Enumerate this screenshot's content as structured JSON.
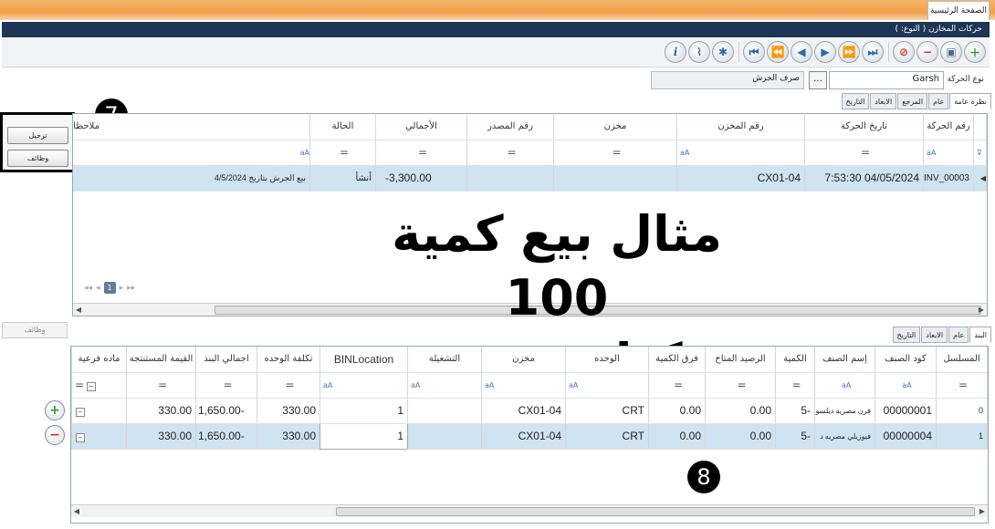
{
  "header": {
    "home_tab": "الصفحة الرئيسية",
    "window_title": "حركات المخازن  ( النوع:  )"
  },
  "toolbar": {
    "buttons": [
      "add-icon",
      "save-icon",
      "remove-icon",
      "cancel-icon",
      "last-icon",
      "next-fast-icon",
      "next-icon",
      "prev-icon",
      "prev-fast-icon",
      "first-icon",
      "export-icon",
      "attach-icon",
      "info-icon"
    ]
  },
  "form": {
    "movement_type_label": "نوع الحركة",
    "movement_type_value": "Garsh",
    "movement_type_name": "صرف الجرش",
    "browse_label": "..."
  },
  "top_tabs": [
    "نظرة عامة",
    "عام",
    "المرجع",
    "الابعاد",
    "التاريخ"
  ],
  "side_buttons": {
    "post": "ترحيل",
    "functions": "وظائف"
  },
  "badges": {
    "b7": "7",
    "b8": "8"
  },
  "header_grid": {
    "columns": [
      "رقم الحركة",
      "تاريخ الحركة",
      "رقم المخزن",
      "مخزن",
      "رقم المصدر",
      "الأجمالي",
      "الحالة",
      "ملاحظات"
    ],
    "filter_marker": "aA",
    "rows": [
      [
        "INV_00003",
        "04/05/2024 7:53:30",
        "CX01-04",
        "",
        "",
        "3,300.00-",
        "أنشأ",
        "بيع الجرش بتاريخ 4/5/2024"
      ]
    ]
  },
  "pager": {
    "page": "1"
  },
  "overlay": {
    "line1": "مثال بيع كمية 100",
    "line2": "كيلو جرش"
  },
  "lines": {
    "functions_label": "وظائف",
    "tabs": [
      "البند",
      "عام",
      "الابعاد",
      "التاريخ"
    ],
    "columns": [
      "المسلسل",
      "كود الصنف",
      "إسم الصنف",
      "الكمية",
      "الرصيد المتاح",
      "فرق الكمية",
      "الوحده",
      "مخزن",
      "التشغيلة",
      "BINLocation",
      "تكلفة الوحده",
      "اجمالي البند",
      "القيمة المستنتجة",
      "ماده فرعية"
    ],
    "rows": [
      [
        "0",
        "00000001",
        "فرن مصريه ديلسو",
        "-5",
        "0.00",
        "0.00",
        "CRT",
        "CX01-04",
        "",
        "1",
        "330.00",
        "-1,650.00",
        "330.00",
        ""
      ],
      [
        "1",
        "00000004",
        "فيوزيلي مصريه د",
        "-5",
        "0.00",
        "0.00",
        "CRT",
        "CX01-04",
        "",
        "1",
        "330.00",
        "-1,650.00",
        "330.00",
        ""
      ]
    ],
    "add_icon": "plus-icon",
    "remove_icon": "minus-icon"
  }
}
